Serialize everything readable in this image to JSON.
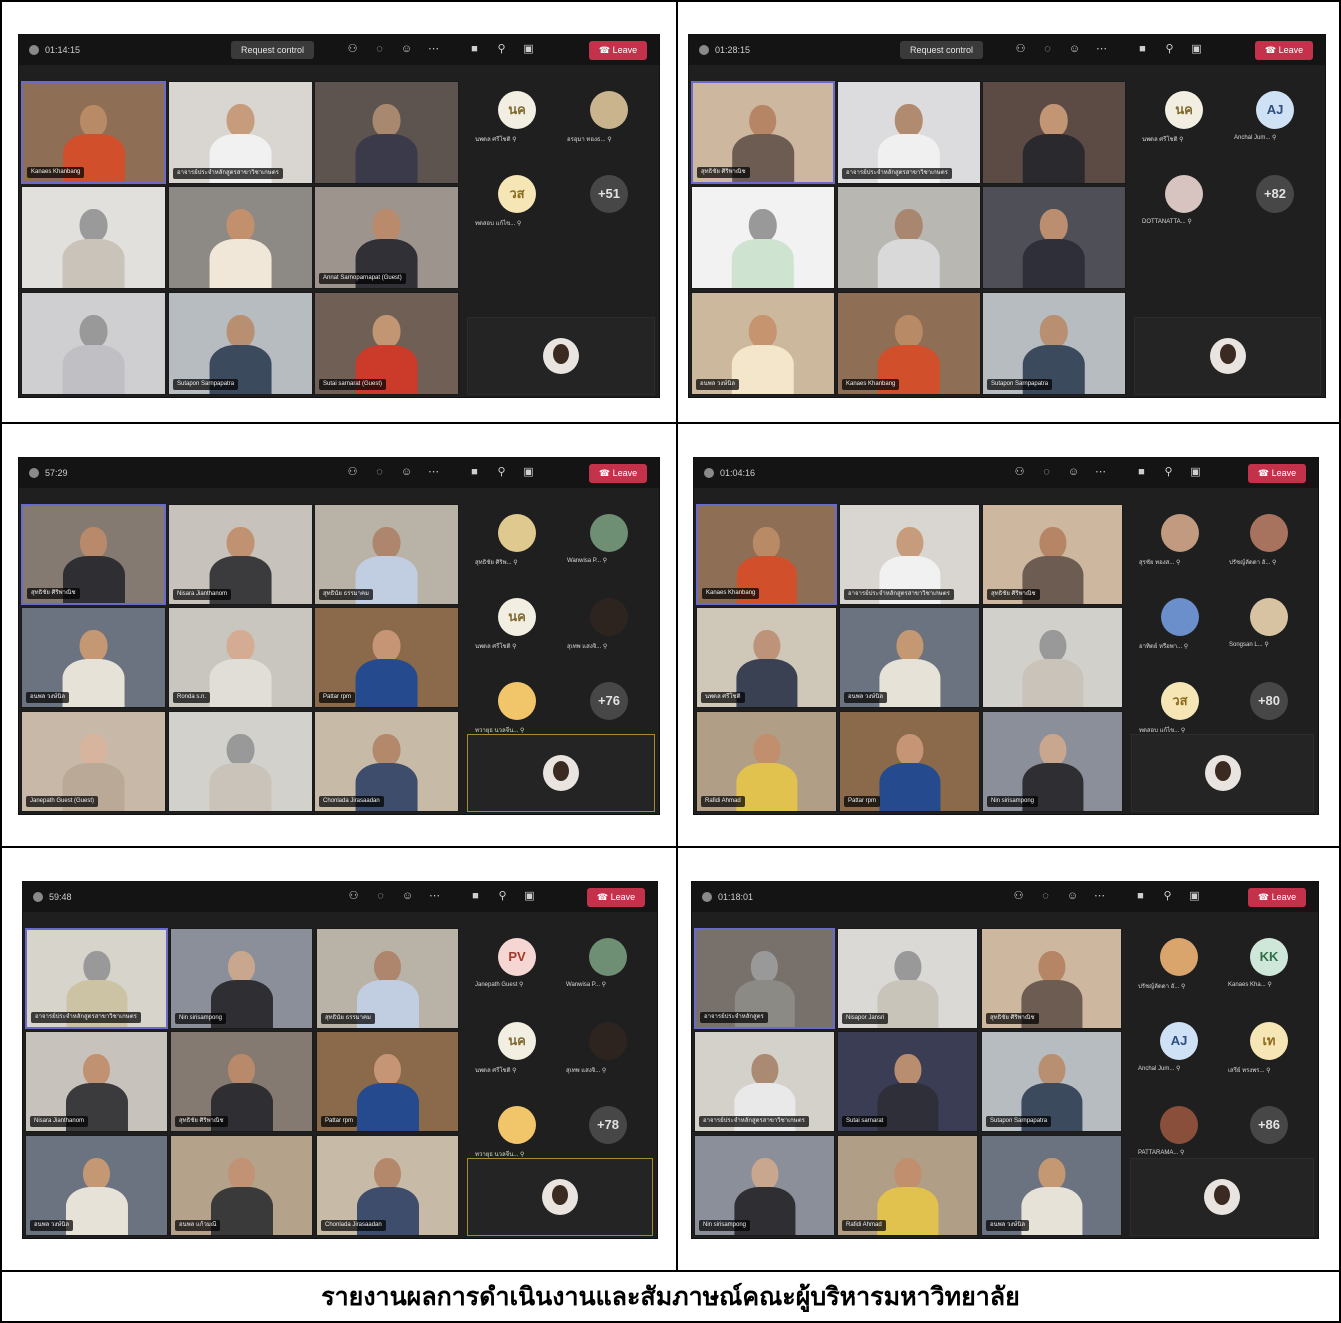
{
  "caption": "รายงานผลการดำเนินงานและสัมภาษณ์คณะผู้บริหารมหาวิทยาลัย",
  "accent_colors": {
    "leave": "#c4314b",
    "toolbar": "#141414",
    "stage": "#1f1f1f",
    "active_border": "#6a6ac8"
  },
  "meeting_toolbar": {
    "request_control_label": "Request control",
    "leave_label": "Leave",
    "icons": [
      "people-icon",
      "chat-icon",
      "react-icon",
      "more-icon",
      "camera-icon",
      "mic-icon",
      "share-icon"
    ]
  },
  "screenshots": [
    {
      "timer": "01:14:15",
      "has_request_control": true,
      "tiles": [
        {
          "name": "Kanaes Khanbang",
          "bg": "#8e6f55",
          "head": "#b98a66",
          "body": "#d24f2c"
        },
        {
          "name": "อาจารย์ประจำหลักสูตรสาขาวิชาเกษตร",
          "bg": "#d9d6d2",
          "head": "#c79c7c",
          "body": "#f1f1f1"
        },
        {
          "name": "",
          "bg": "#5d5450",
          "head": "#a98870",
          "body": "#3a3a4a"
        },
        {
          "name": "",
          "bg": "#e2e0dc",
          "head": "#9a9a9a",
          "body": "#c9c3b9"
        },
        {
          "name": "",
          "bg": "#8d8a86",
          "head": "#c3906d",
          "body": "#f0e7d8"
        },
        {
          "name": "Annat Sarnoparnapat (Guest)",
          "bg": "#9d958d",
          "head": "#b98a6b",
          "body": "#303036"
        },
        {
          "name": "",
          "bg": "#cfcfd2",
          "head": "#999",
          "body": "#bfbfc4"
        },
        {
          "name": "Sutapon Sarnpapatra",
          "bg": "#b7bcc0",
          "head": "#b88f70",
          "body": "#3c4a5e"
        },
        {
          "name": "Sutai sarnarat (Guest)",
          "bg": "#6f5f55",
          "head": "#c29673",
          "body": "#cc3a2a"
        }
      ],
      "side": [
        {
          "initials": "นค",
          "label": "นพดล ศรีโชติ",
          "bg": "#f2eee2",
          "fg": "#7d6a2e"
        },
        {
          "initials": "",
          "label": "อรอุมา ทองธ...",
          "bg": "#c9b48e",
          "fg": "#fff"
        },
        {
          "initials": "วส",
          "label": "ทดสอบ แก้ไข...",
          "bg": "#f7e6b5",
          "fg": "#8a6a1c"
        },
        {
          "initials": "+51",
          "label": "",
          "bg": "#474747",
          "fg": "#e2e2e2"
        }
      ]
    },
    {
      "timer": "01:28:15",
      "has_request_control": true,
      "tiles": [
        {
          "name": "สุทธิชัย ศิริพาณิช",
          "bg": "#cdb79f",
          "head": "#b58566",
          "body": "#6d5c52"
        },
        {
          "name": "อาจารย์ประจำหลักสูตรสาขาวิชาเกษตร",
          "bg": "#dcdcde",
          "head": "#b08b70",
          "body": "#f0f0f0"
        },
        {
          "name": "",
          "bg": "#5c4b45",
          "head": "#c29574",
          "body": "#2a2a2e"
        },
        {
          "name": "",
          "bg": "#f2f2f2",
          "head": "#999",
          "body": "#cfe3d1"
        },
        {
          "name": "",
          "bg": "#b9b7b2",
          "head": "#a88670",
          "body": "#d9d9d9"
        },
        {
          "name": "",
          "bg": "#4f4f57",
          "head": "#bb8e70",
          "body": "#2f2f3a"
        },
        {
          "name": "อนพล วงษ์นิล",
          "bg": "#ccb89d",
          "head": "#c6946f",
          "body": "#f3e6cb"
        },
        {
          "name": "Kanaes Khanbang",
          "bg": "#8e6f55",
          "head": "#b98a66",
          "body": "#d24f2c"
        },
        {
          "name": "Sutapon Sarnpapatra",
          "bg": "#b7bcc0",
          "head": "#b88f70",
          "body": "#3c4a5e"
        }
      ],
      "side": [
        {
          "initials": "นค",
          "label": "นพดล ศรีโชติ",
          "bg": "#f2eee2",
          "fg": "#7d6a2e"
        },
        {
          "initials": "AJ",
          "label": "Anchal Jum...",
          "bg": "#cfe1f5",
          "fg": "#2f4d7d"
        },
        {
          "initials": "",
          "label": "DOTTANATTA...",
          "bg": "#d7c3c0",
          "fg": "#fff"
        },
        {
          "initials": "+82",
          "label": "",
          "bg": "#474747",
          "fg": "#e2e2e2"
        }
      ]
    },
    {
      "timer": "57:29",
      "has_request_control": false,
      "tiles": [
        {
          "name": "สุทธิชัย ศิริพาณิช",
          "bg": "#857a71",
          "head": "#b9896b",
          "body": "#2f2f33"
        },
        {
          "name": "Nisara Jianthanom",
          "bg": "#c8c2bc",
          "head": "#c19272",
          "body": "#3b3b3d"
        },
        {
          "name": "สุทธินัย ธรรมาคม",
          "bg": "#b9b2a6",
          "head": "#ad866d",
          "body": "#c1cde0"
        },
        {
          "name": "อนพล วงษ์นิล",
          "bg": "#6b7380",
          "head": "#c59874",
          "body": "#e6e2d8"
        },
        {
          "name": "Ronda s.n.",
          "bg": "#c9c6bf",
          "head": "#d3ac93",
          "body": "#e1ded7"
        },
        {
          "name": "Pattar rpm",
          "bg": "#8a6a4a",
          "head": "#c59575",
          "body": "#264a8e"
        },
        {
          "name": "Janepath Guest (Guest)",
          "bg": "#c8b8a7",
          "head": "#d7b49d",
          "body": "#b9a996"
        },
        {
          "name": "",
          "bg": "#d3d1cc",
          "head": "#999",
          "body": "#c9c3b9"
        },
        {
          "name": "Chonlada Jirasaadan",
          "bg": "#c7bba8",
          "head": "#b3886b",
          "body": "#3e4d6b"
        }
      ],
      "side": [
        {
          "initials": "",
          "label": "สุทธิชัย ศิริพ...",
          "bg": "#e0c98e",
          "fg": "#fff"
        },
        {
          "initials": "",
          "label": "Wanwisa P...",
          "bg": "#6e8f74",
          "fg": "#fff"
        },
        {
          "initials": "นค",
          "label": "นพดล ศรีโชติ",
          "bg": "#f2eee2",
          "fg": "#7d6a2e"
        },
        {
          "initials": "",
          "label": "สุเทพ แสงจิ...",
          "bg": "#2d2420",
          "fg": "#fff"
        },
        {
          "initials": "",
          "label": "ทวายุธ นวลจีน...",
          "bg": "#f1c66b",
          "fg": "#fff"
        },
        {
          "initials": "+76",
          "label": "",
          "bg": "#474747",
          "fg": "#e2e2e2"
        }
      ]
    },
    {
      "timer": "01:04:16",
      "has_request_control": false,
      "tiles": [
        {
          "name": "Kanaes Khanbang",
          "bg": "#8e6f55",
          "head": "#b98a66",
          "body": "#d24f2c"
        },
        {
          "name": "อาจารย์ประจำหลักสูตรสาขาวิชาเกษตร",
          "bg": "#d9d6d2",
          "head": "#c79c7c",
          "body": "#f1f1f1"
        },
        {
          "name": "สุทธิชัย ศิริพาณิช",
          "bg": "#cdb79f",
          "head": "#b58566",
          "body": "#6d5c52"
        },
        {
          "name": "นพดล ศรีโชติ",
          "bg": "#cfc7b8",
          "head": "#bd9379",
          "body": "#3a4152"
        },
        {
          "name": "อนพล วงษ์นิล",
          "bg": "#6b7380",
          "head": "#c59874",
          "body": "#e6e2d8"
        },
        {
          "name": "",
          "bg": "#d2d0cb",
          "head": "#999",
          "body": "#c9c3b9"
        },
        {
          "name": "Rafidi Ahmad",
          "bg": "#b09e87",
          "head": "#c18e6e",
          "body": "#e1c24e"
        },
        {
          "name": "Pattar rpm",
          "bg": "#8a6a4a",
          "head": "#c59575",
          "body": "#264a8e"
        },
        {
          "name": "Nin sirisampong",
          "bg": "#8a8f99",
          "head": "#c9a68e",
          "body": "#2e2e33"
        }
      ],
      "side": [
        {
          "initials": "",
          "label": "สุรชัย ทองส...",
          "bg": "#c29a80",
          "fg": "#fff"
        },
        {
          "initials": "",
          "label": "ปรัชญ์ลัดดา อั...",
          "bg": "#a7735e",
          "fg": "#fff"
        },
        {
          "initials": "",
          "label": "อาทิตย์ หรือพา...",
          "bg": "#6a8fcb",
          "fg": "#fff"
        },
        {
          "initials": "",
          "label": "Songsan L...",
          "bg": "#d7c3a2",
          "fg": "#fff"
        },
        {
          "initials": "วส",
          "label": "ทดสอบ แก้ไข...",
          "bg": "#f7e6b5",
          "fg": "#8a6a1c"
        },
        {
          "initials": "+80",
          "label": "",
          "bg": "#474747",
          "fg": "#e2e2e2"
        }
      ]
    },
    {
      "timer": "59:48",
      "has_request_control": false,
      "tiles": [
        {
          "name": "อาจารย์ประจำหลักสูตรสาขาวิชาเกษตร",
          "bg": "#d7d4cc",
          "head": "#999",
          "body": "#ccc3a5"
        },
        {
          "name": "Nin sirisampong",
          "bg": "#8a8f99",
          "head": "#c9a68e",
          "body": "#2e2e33"
        },
        {
          "name": "สุทธินัย ธรรมาคม",
          "bg": "#b9b2a6",
          "head": "#ad866d",
          "body": "#c1cde0"
        },
        {
          "name": "Nisara Jianthanom",
          "bg": "#c8c2bc",
          "head": "#c19272",
          "body": "#3b3b3d"
        },
        {
          "name": "สุทธิชัย ศิริพาณิช",
          "bg": "#857a71",
          "head": "#b9896b",
          "body": "#2f2f33"
        },
        {
          "name": "Pattar rpm",
          "bg": "#8a6a4a",
          "head": "#c59575",
          "body": "#264a8e"
        },
        {
          "name": "อนพล วงษ์นิล",
          "bg": "#6b7380",
          "head": "#c59874",
          "body": "#e6e2d8"
        },
        {
          "name": "อนพล แก้วมณี",
          "bg": "#b4a28a",
          "head": "#c29275",
          "body": "#3a3a3a"
        },
        {
          "name": "Chonlada Jirasaadan",
          "bg": "#c7bba8",
          "head": "#b3886b",
          "body": "#3e4d6b"
        }
      ],
      "side": [
        {
          "initials": "PV",
          "label": "Janepath Guest",
          "bg": "#f6d6d2",
          "fg": "#a23a2a"
        },
        {
          "initials": "",
          "label": "Wanwisa P...",
          "bg": "#6e8f74",
          "fg": "#fff"
        },
        {
          "initials": "นค",
          "label": "นพดล ศรีโชติ",
          "bg": "#f2eee2",
          "fg": "#7d6a2e"
        },
        {
          "initials": "",
          "label": "สุเทพ แสงจิ...",
          "bg": "#2d2420",
          "fg": "#fff"
        },
        {
          "initials": "",
          "label": "ทวายุธ นวลจีน...",
          "bg": "#f1c66b",
          "fg": "#fff"
        },
        {
          "initials": "+78",
          "label": "",
          "bg": "#474747",
          "fg": "#e2e2e2"
        }
      ]
    },
    {
      "timer": "01:18:01",
      "has_request_control": false,
      "tiles": [
        {
          "name": "อาจารย์ประจำหลักสูตร",
          "bg": "#78706a",
          "head": "#999",
          "body": "#8b8a84"
        },
        {
          "name": "Nisapor Jansri",
          "bg": "#dad9d6",
          "head": "#999",
          "body": "#c8c4ba"
        },
        {
          "name": "สุทธิชัย ศิริพาณิช",
          "bg": "#cdb79f",
          "head": "#b58566",
          "body": "#6d5c52"
        },
        {
          "name": "อาจารย์ประจำหลักสูตรสาขาวิชาเกษตร",
          "bg": "#d4d1cb",
          "head": "#aa8a72",
          "body": "#e9e9e9"
        },
        {
          "name": "Sutai sarnarat",
          "bg": "#3b3d55",
          "head": "#b98d70",
          "body": "#2f2f3a"
        },
        {
          "name": "Sutapon Sarnpapatra",
          "bg": "#b7bcc0",
          "head": "#b88f70",
          "body": "#3c4a5e"
        },
        {
          "name": "Nin sirisampong",
          "bg": "#8a8f99",
          "head": "#c9a68e",
          "body": "#2e2e33"
        },
        {
          "name": "Rafidi Ahmad",
          "bg": "#b09e87",
          "head": "#c18e6e",
          "body": "#e1c24e"
        },
        {
          "name": "อนพล วงษ์นิล",
          "bg": "#6b7380",
          "head": "#c59874",
          "body": "#e6e2d8"
        }
      ],
      "side": [
        {
          "initials": "",
          "label": "ปรัชญ์ลัดดา อั...",
          "bg": "#d9a56d",
          "fg": "#fff"
        },
        {
          "initials": "KK",
          "label": "Kanaes Kha...",
          "bg": "#cfe7d8",
          "fg": "#2e6f4a"
        },
        {
          "initials": "AJ",
          "label": "Anchal Jum...",
          "bg": "#cfe1f5",
          "fg": "#2f4d7d"
        },
        {
          "initials": "เท",
          "label": "เสรีย์ ทรงพร...",
          "bg": "#f7e6b5",
          "fg": "#8a6a1c"
        },
        {
          "initials": "",
          "label": "PATTARAMA...",
          "bg": "#8a4f3a",
          "fg": "#fff"
        },
        {
          "initials": "+86",
          "label": "",
          "bg": "#474747",
          "fg": "#e2e2e2"
        }
      ]
    }
  ]
}
